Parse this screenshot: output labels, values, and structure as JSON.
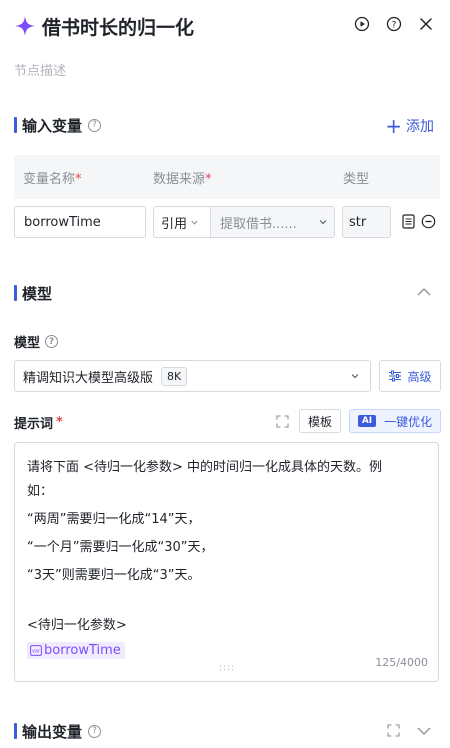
{
  "header": {
    "title": "借书时长的归一化",
    "description_placeholder": "节点描述"
  },
  "inputs": {
    "title": "输入变量",
    "add_label": "添加",
    "columns": {
      "name": "变量名称",
      "source": "数据来源",
      "type": "类型"
    },
    "required_mark": "*",
    "row": {
      "name": "borrowTime",
      "source_mode": "引用",
      "source_value": "提取借书......",
      "type": "str"
    }
  },
  "model_section": {
    "title": "模型",
    "model_label": "模型",
    "model_name": "精调知识大模型高级版",
    "model_badge": "8K",
    "advanced_label": "高级"
  },
  "prompt": {
    "label": "提示词",
    "required_mark": "*",
    "template_label": "模板",
    "ai_badge": "AI",
    "optimize_label": "一键优化",
    "lines": [
      "请将下面 <待归一化参数> 中的时间归一化成具体的天数。例",
      "如：",
      "“两周”需要归一化成“14”天，",
      "“一个月”需要归一化成“30”天，",
      "“3天”则需要归一化成“3”天。",
      "",
      "<待归一化参数>"
    ],
    "variable_tag": "borrowTime",
    "counter": "125/4000"
  },
  "outputs": {
    "title": "输出变量"
  },
  "colors": {
    "accent": "#3b5bdb",
    "purple": "#7c4dff",
    "required": "#e5484d"
  }
}
